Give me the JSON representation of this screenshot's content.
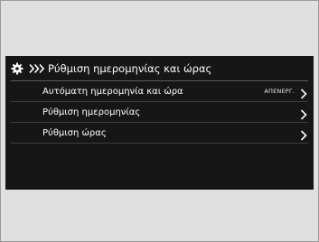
{
  "screen": {
    "header": {
      "icon": "gear-icon",
      "nav_icon": "double-chevron-right-icon",
      "title": "Ρύθμιση ημερομηνίας και ώρας"
    },
    "items": [
      {
        "label": "Αυτόματη ημερομηνία και ώρα",
        "value": "ΑΠΕΝΕΡΓ.",
        "icon": "chevron-right-icon"
      },
      {
        "label": "Ρύθμιση ημερομηνίας",
        "icon": "chevron-right-icon"
      },
      {
        "label": "Ρύθμιση ώρας",
        "icon": "chevron-right-icon"
      }
    ]
  },
  "colors": {
    "screen_background": "#161616",
    "text": "#ffffff",
    "page_background": "#e0e0e0"
  }
}
